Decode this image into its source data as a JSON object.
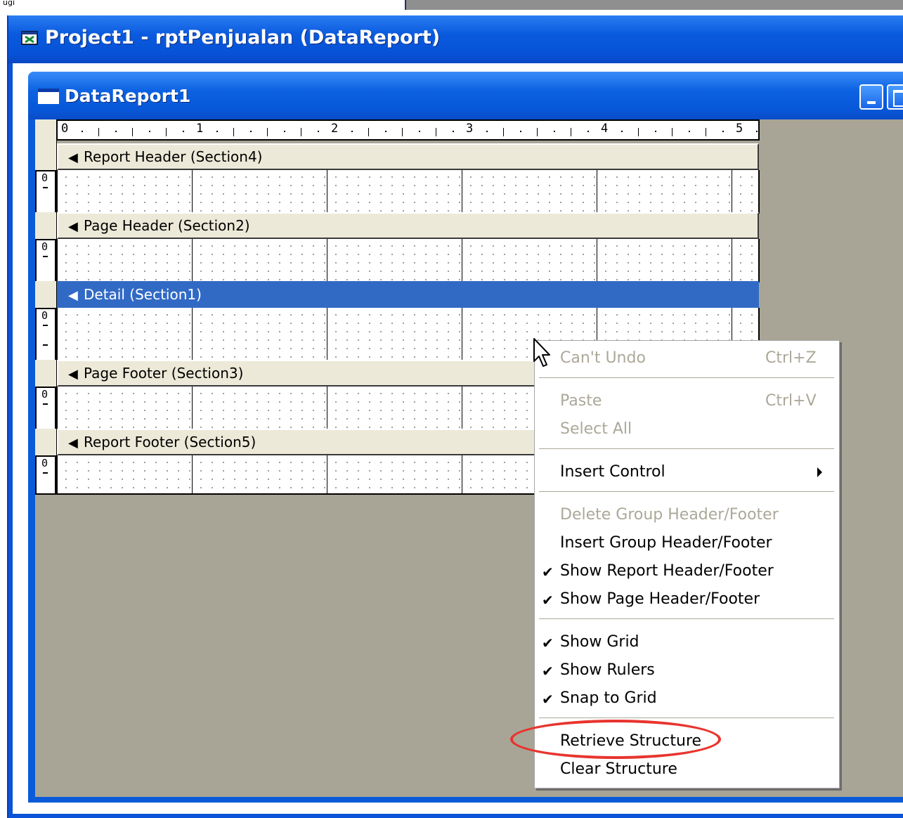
{
  "background": {
    "corner_text": "ugi"
  },
  "window": {
    "title": "Project1 - rptPenjualan (DataReport)",
    "accent": "#0a5bd9"
  },
  "report_window": {
    "title": "DataReport1"
  },
  "ruler": {
    "labels": [
      "0",
      "1",
      "2",
      "3",
      "4",
      "5"
    ]
  },
  "sections": [
    {
      "label": "Report Header (Section4)",
      "ruler": "0",
      "selected": false
    },
    {
      "label": "Page Header (Section2)",
      "ruler": "0",
      "selected": false
    },
    {
      "label": "Detail (Section1)",
      "ruler": "0",
      "selected": true
    },
    {
      "label": "Page Footer (Section3)",
      "ruler": "0",
      "selected": false
    },
    {
      "label": "Report Footer (Section5)",
      "ruler": "0",
      "selected": false
    }
  ],
  "context_menu": {
    "undo": {
      "label": "Can't Undo",
      "shortcut": "Ctrl+Z",
      "enabled": false
    },
    "paste": {
      "label": "Paste",
      "shortcut": "Ctrl+V",
      "enabled": false
    },
    "select_all": {
      "label": "Select All",
      "enabled": false
    },
    "insert_control": {
      "label": "Insert Control",
      "submenu": true
    },
    "delete_group": {
      "label": "Delete Group Header/Footer",
      "enabled": false
    },
    "insert_group": {
      "label": "Insert Group Header/Footer"
    },
    "show_report_hf": {
      "label": "Show Report Header/Footer",
      "checked": true
    },
    "show_page_hf": {
      "label": "Show Page Header/Footer",
      "checked": true
    },
    "show_grid": {
      "label": "Show Grid",
      "checked": true
    },
    "show_rulers": {
      "label": "Show Rulers",
      "checked": true
    },
    "snap_to_grid": {
      "label": "Snap to Grid",
      "checked": true
    },
    "retrieve_structure": {
      "label": "Retrieve Structure",
      "highlighted": true
    },
    "clear_structure": {
      "label": "Clear Structure"
    }
  },
  "colors": {
    "highlight_ring": "#e8342e",
    "selected_band": "#316ac5",
    "workspace": "#a8a597"
  }
}
